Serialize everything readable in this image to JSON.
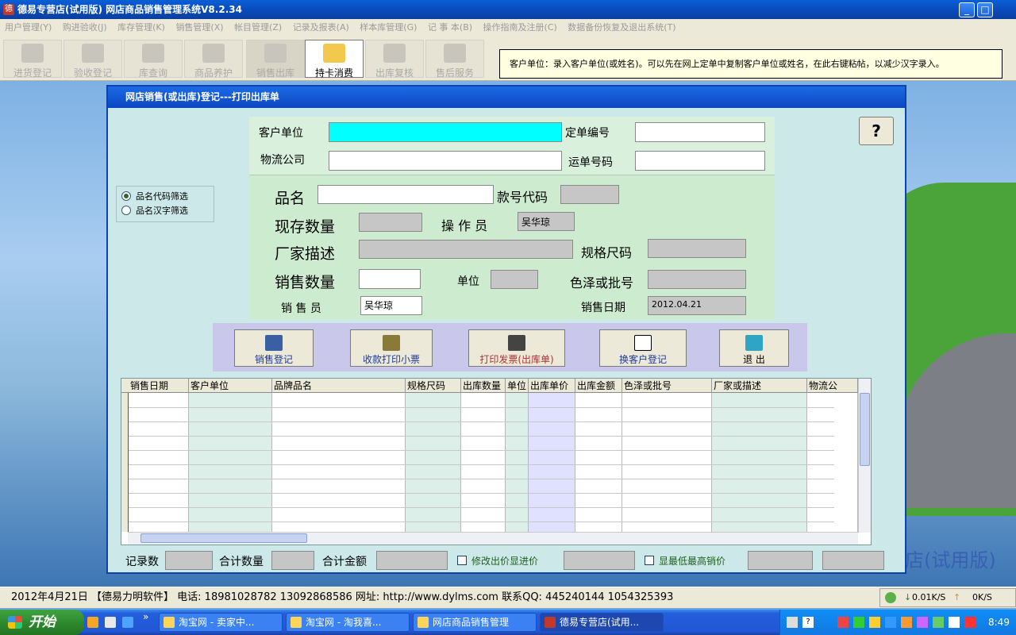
{
  "window": {
    "title": "德易专营店(试用版) 网店商品销售管理系统V8.2.34",
    "icon": "app-icon",
    "controls": [
      "_",
      "□"
    ]
  },
  "menu": [
    "用户管理(Y)",
    "购进验收(J)",
    "库存管理(K)",
    "销售管理(X)",
    "帐目管理(Z)",
    "记录及报表(A)",
    "样本库管理(G)",
    "记 事 本(B)",
    "操作指南及注册(C)",
    "数据备份恢复及退出系统(T)"
  ],
  "toolbar": {
    "items": [
      {
        "label": "进货登记"
      },
      {
        "label": "验收登记"
      },
      {
        "label": "库查询"
      },
      {
        "label": "商品养护"
      },
      {
        "label": "销售出库"
      },
      {
        "label": "持卡消费"
      },
      {
        "label": "出库复核"
      },
      {
        "label": "售后服务"
      }
    ]
  },
  "tooltip": "客户单位：录入客户单位(或姓名)。可以先在网上定单中复制客户单位或姓名，在此右键粘帖，以减少汉字录入。",
  "dialog": {
    "title": "网店销售(或出库)登记---打印出库单",
    "fields": {
      "customer": "客户单位",
      "order_no": "定单编号",
      "logistics": "物流公司",
      "waybill": "运单号码",
      "product": "品名",
      "style_code": "款号代码",
      "stock_qty": "现存数量",
      "operator": "操 作 员",
      "operator_value": "吴华琼",
      "maker_desc": "厂家描述",
      "spec_code": "规格尺码",
      "sale_qty": "销售数量",
      "unit": "单位",
      "color_batch": "色泽或批号",
      "salesperson": "销 售 员",
      "salesperson_value": "吴华琼",
      "sale_date": "销售日期",
      "sale_date_value": "2012.04.21"
    },
    "filter": {
      "options": [
        "品名代码筛选",
        "品名汉字筛选"
      ],
      "selected": 0
    },
    "help_label": "?",
    "actions": [
      "销售登记",
      "收款打印小票",
      "打印发票(出库单)",
      "换客户登记",
      "退 出"
    ],
    "grid": {
      "columns": [
        "销售日期",
        "客户单位",
        "品牌品名",
        "规格尺码",
        "出库数量",
        "单位",
        "出库单价",
        "出库金额",
        "色泽或批号",
        "厂家或描述",
        "物流公"
      ]
    },
    "footer": {
      "record_count": "记录数",
      "total_qty": "合计数量",
      "total_amount": "合计金额",
      "chk_modify_price": "修改出价显进价",
      "chk_show_min_max": "显最低最高销价"
    }
  },
  "watermark": "店(试用版)",
  "statusbar": "2012年4月21日 【德易力明软件】 电话: 18981028782 13092868586 网址: http://www.dylms.com 联系QQ: 445240144 1054325393",
  "net": {
    "down": "0.01K/S",
    "up": "0K/S"
  },
  "taskbar": {
    "start": "开始",
    "quicklaunch": "»",
    "tasks": [
      "淘宝网 - 卖家中...",
      "淘宝网 - 淘我喜...",
      "网店商品销售管理",
      "德易专营店(试用..."
    ],
    "active": 3,
    "clock": "8:49"
  },
  "colors": {
    "title_blue": "#0948b8",
    "dialog_bg": "#cce8e8",
    "panel_green": "#cdeccf",
    "customer_input": "#00ffff",
    "button_bar": "#c9c8ea",
    "price_column": "#e0e0ff"
  }
}
